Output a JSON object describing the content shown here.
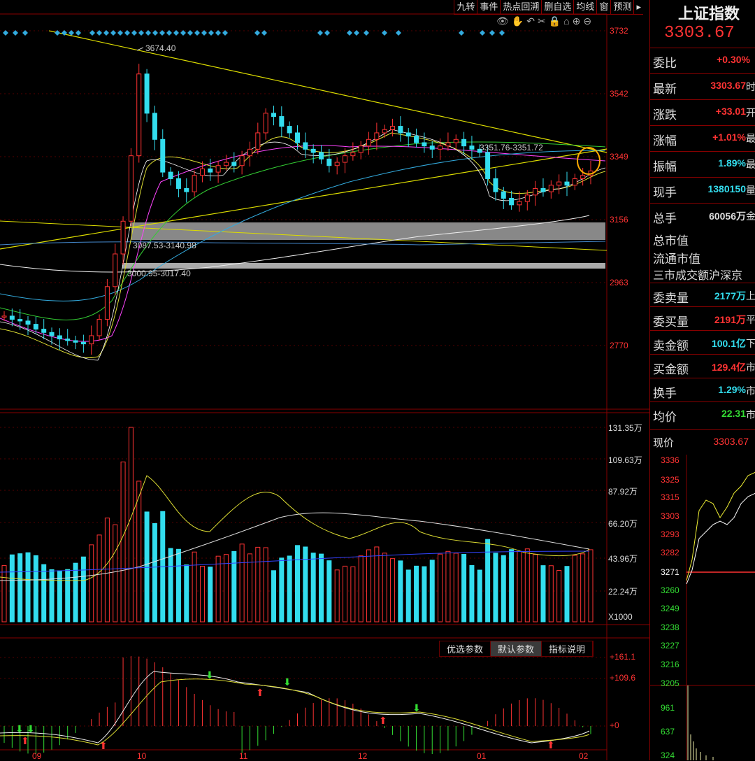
{
  "toolbar": [
    "九转",
    "事件",
    "热点回溯",
    "删自选",
    "均线",
    "窗",
    "预测"
  ],
  "toolbar_end": "▸",
  "price_axis": [
    "3732",
    "3542",
    "3349",
    "3156",
    "2963",
    "2770"
  ],
  "volume_axis": [
    "131.35万",
    "109.63万",
    "87.92万",
    "66.20万",
    "43.96万",
    "22.24万"
  ],
  "volume_unit": "X1000",
  "osc_axis": [
    "+161.1",
    "+109.6",
    "+0"
  ],
  "x_labels": [
    "09",
    "10",
    "11",
    "12",
    "01",
    "02"
  ],
  "annotations": {
    "high": "3674.40",
    "trend": "3351.76-3351.72",
    "zone1": "3087.53-3140.98",
    "zone2": "3000.95-3017.40"
  },
  "params": [
    "优选参数",
    "默认参数",
    "指标说明"
  ],
  "panel": {
    "title": "上证指数",
    "price": "3303.67",
    "rows": [
      {
        "label": "委比",
        "value": "+0.30%",
        "color": "#ff3333",
        "cut": ""
      },
      {
        "label": "最新",
        "value": "3303.67",
        "color": "#ff3333",
        "cut": "时"
      },
      {
        "label": "涨跌",
        "value": "+33.01",
        "color": "#ff3333",
        "cut": "开"
      },
      {
        "label": "涨幅",
        "value": "+1.01%",
        "color": "#ff3333",
        "cut": "最"
      },
      {
        "label": "振幅",
        "value": "1.89%",
        "color": "#33ddee",
        "cut": "最"
      },
      {
        "label": "现手",
        "value": "1380150",
        "color": "#33ddee",
        "cut": "量"
      },
      {
        "label": "总手",
        "value": "60056万",
        "color": "#dddddd",
        "cut": "金"
      }
    ],
    "lines": [
      "总市值",
      "流通市值",
      "三市成交额沪深京"
    ],
    "rows2": [
      {
        "label": "委卖量",
        "value": "2177万",
        "color": "#33ddee",
        "cut": "上"
      },
      {
        "label": "委买量",
        "value": "2191万",
        "color": "#ff3333",
        "cut": "平"
      },
      {
        "label": "卖金额",
        "value": "100.1亿",
        "color": "#33ddee",
        "cut": "下"
      },
      {
        "label": "买金额",
        "value": "129.4亿",
        "color": "#ff3333",
        "cut": "市"
      },
      {
        "label": "换手",
        "value": "1.29%",
        "color": "#33ddee",
        "cut": "市"
      },
      {
        "label": "均价",
        "value": "22.31",
        "color": "#33dd33",
        "cut": "市"
      }
    ],
    "mini_label": "现价",
    "mini_price": "3303.67",
    "mini_axis": [
      "3336",
      "3325",
      "3315",
      "3303",
      "3293",
      "3282",
      "3271",
      "3260",
      "3249",
      "3238",
      "3227",
      "3216",
      "3205",
      "961",
      "637",
      "324"
    ]
  },
  "chart_data": {
    "type": "candlestick",
    "x_labels": [
      "09",
      "10",
      "11",
      "12",
      "01",
      "02"
    ],
    "closes": [
      2860,
      2850,
      2845,
      2835,
      2820,
      2810,
      2800,
      2790,
      2785,
      2780,
      2775,
      2800,
      2850,
      2950,
      3050,
      3150,
      3350,
      3600,
      3480,
      3400,
      3300,
      3280,
      3250,
      3240,
      3290,
      3310,
      3300,
      3320,
      3330,
      3320,
      3350,
      3370,
      3420,
      3480,
      3470,
      3440,
      3420,
      3390,
      3370,
      3360,
      3340,
      3320,
      3330,
      3350,
      3360,
      3380,
      3400,
      3420,
      3430,
      3440,
      3420,
      3410,
      3390,
      3380,
      3370,
      3380,
      3390,
      3400,
      3380,
      3370,
      3360,
      3280,
      3240,
      3220,
      3200,
      3210,
      3230,
      3250,
      3240,
      3260,
      3270,
      3260,
      3280,
      3290,
      3303.67
    ],
    "ylim": [
      2680,
      3760
    ],
    "volume_ylim": [
      0,
      1313500
    ],
    "colors": {
      "up": "#ff3333",
      "down": "#33ddee"
    }
  }
}
